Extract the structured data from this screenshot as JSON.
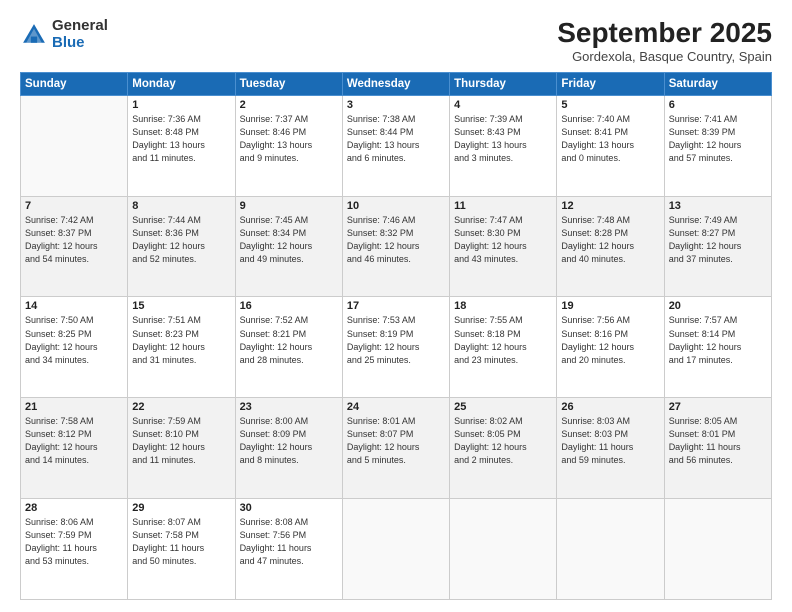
{
  "header": {
    "logo_general": "General",
    "logo_blue": "Blue",
    "month_title": "September 2025",
    "location": "Gordexola, Basque Country, Spain"
  },
  "weekdays": [
    "Sunday",
    "Monday",
    "Tuesday",
    "Wednesday",
    "Thursday",
    "Friday",
    "Saturday"
  ],
  "weeks": [
    [
      {
        "day": "",
        "detail": ""
      },
      {
        "day": "1",
        "detail": "Sunrise: 7:36 AM\nSunset: 8:48 PM\nDaylight: 13 hours\nand 11 minutes."
      },
      {
        "day": "2",
        "detail": "Sunrise: 7:37 AM\nSunset: 8:46 PM\nDaylight: 13 hours\nand 9 minutes."
      },
      {
        "day": "3",
        "detail": "Sunrise: 7:38 AM\nSunset: 8:44 PM\nDaylight: 13 hours\nand 6 minutes."
      },
      {
        "day": "4",
        "detail": "Sunrise: 7:39 AM\nSunset: 8:43 PM\nDaylight: 13 hours\nand 3 minutes."
      },
      {
        "day": "5",
        "detail": "Sunrise: 7:40 AM\nSunset: 8:41 PM\nDaylight: 13 hours\nand 0 minutes."
      },
      {
        "day": "6",
        "detail": "Sunrise: 7:41 AM\nSunset: 8:39 PM\nDaylight: 12 hours\nand 57 minutes."
      }
    ],
    [
      {
        "day": "7",
        "detail": "Sunrise: 7:42 AM\nSunset: 8:37 PM\nDaylight: 12 hours\nand 54 minutes."
      },
      {
        "day": "8",
        "detail": "Sunrise: 7:44 AM\nSunset: 8:36 PM\nDaylight: 12 hours\nand 52 minutes."
      },
      {
        "day": "9",
        "detail": "Sunrise: 7:45 AM\nSunset: 8:34 PM\nDaylight: 12 hours\nand 49 minutes."
      },
      {
        "day": "10",
        "detail": "Sunrise: 7:46 AM\nSunset: 8:32 PM\nDaylight: 12 hours\nand 46 minutes."
      },
      {
        "day": "11",
        "detail": "Sunrise: 7:47 AM\nSunset: 8:30 PM\nDaylight: 12 hours\nand 43 minutes."
      },
      {
        "day": "12",
        "detail": "Sunrise: 7:48 AM\nSunset: 8:28 PM\nDaylight: 12 hours\nand 40 minutes."
      },
      {
        "day": "13",
        "detail": "Sunrise: 7:49 AM\nSunset: 8:27 PM\nDaylight: 12 hours\nand 37 minutes."
      }
    ],
    [
      {
        "day": "14",
        "detail": "Sunrise: 7:50 AM\nSunset: 8:25 PM\nDaylight: 12 hours\nand 34 minutes."
      },
      {
        "day": "15",
        "detail": "Sunrise: 7:51 AM\nSunset: 8:23 PM\nDaylight: 12 hours\nand 31 minutes."
      },
      {
        "day": "16",
        "detail": "Sunrise: 7:52 AM\nSunset: 8:21 PM\nDaylight: 12 hours\nand 28 minutes."
      },
      {
        "day": "17",
        "detail": "Sunrise: 7:53 AM\nSunset: 8:19 PM\nDaylight: 12 hours\nand 25 minutes."
      },
      {
        "day": "18",
        "detail": "Sunrise: 7:55 AM\nSunset: 8:18 PM\nDaylight: 12 hours\nand 23 minutes."
      },
      {
        "day": "19",
        "detail": "Sunrise: 7:56 AM\nSunset: 8:16 PM\nDaylight: 12 hours\nand 20 minutes."
      },
      {
        "day": "20",
        "detail": "Sunrise: 7:57 AM\nSunset: 8:14 PM\nDaylight: 12 hours\nand 17 minutes."
      }
    ],
    [
      {
        "day": "21",
        "detail": "Sunrise: 7:58 AM\nSunset: 8:12 PM\nDaylight: 12 hours\nand 14 minutes."
      },
      {
        "day": "22",
        "detail": "Sunrise: 7:59 AM\nSunset: 8:10 PM\nDaylight: 12 hours\nand 11 minutes."
      },
      {
        "day": "23",
        "detail": "Sunrise: 8:00 AM\nSunset: 8:09 PM\nDaylight: 12 hours\nand 8 minutes."
      },
      {
        "day": "24",
        "detail": "Sunrise: 8:01 AM\nSunset: 8:07 PM\nDaylight: 12 hours\nand 5 minutes."
      },
      {
        "day": "25",
        "detail": "Sunrise: 8:02 AM\nSunset: 8:05 PM\nDaylight: 12 hours\nand 2 minutes."
      },
      {
        "day": "26",
        "detail": "Sunrise: 8:03 AM\nSunset: 8:03 PM\nDaylight: 11 hours\nand 59 minutes."
      },
      {
        "day": "27",
        "detail": "Sunrise: 8:05 AM\nSunset: 8:01 PM\nDaylight: 11 hours\nand 56 minutes."
      }
    ],
    [
      {
        "day": "28",
        "detail": "Sunrise: 8:06 AM\nSunset: 7:59 PM\nDaylight: 11 hours\nand 53 minutes."
      },
      {
        "day": "29",
        "detail": "Sunrise: 8:07 AM\nSunset: 7:58 PM\nDaylight: 11 hours\nand 50 minutes."
      },
      {
        "day": "30",
        "detail": "Sunrise: 8:08 AM\nSunset: 7:56 PM\nDaylight: 11 hours\nand 47 minutes."
      },
      {
        "day": "",
        "detail": ""
      },
      {
        "day": "",
        "detail": ""
      },
      {
        "day": "",
        "detail": ""
      },
      {
        "day": "",
        "detail": ""
      }
    ]
  ]
}
